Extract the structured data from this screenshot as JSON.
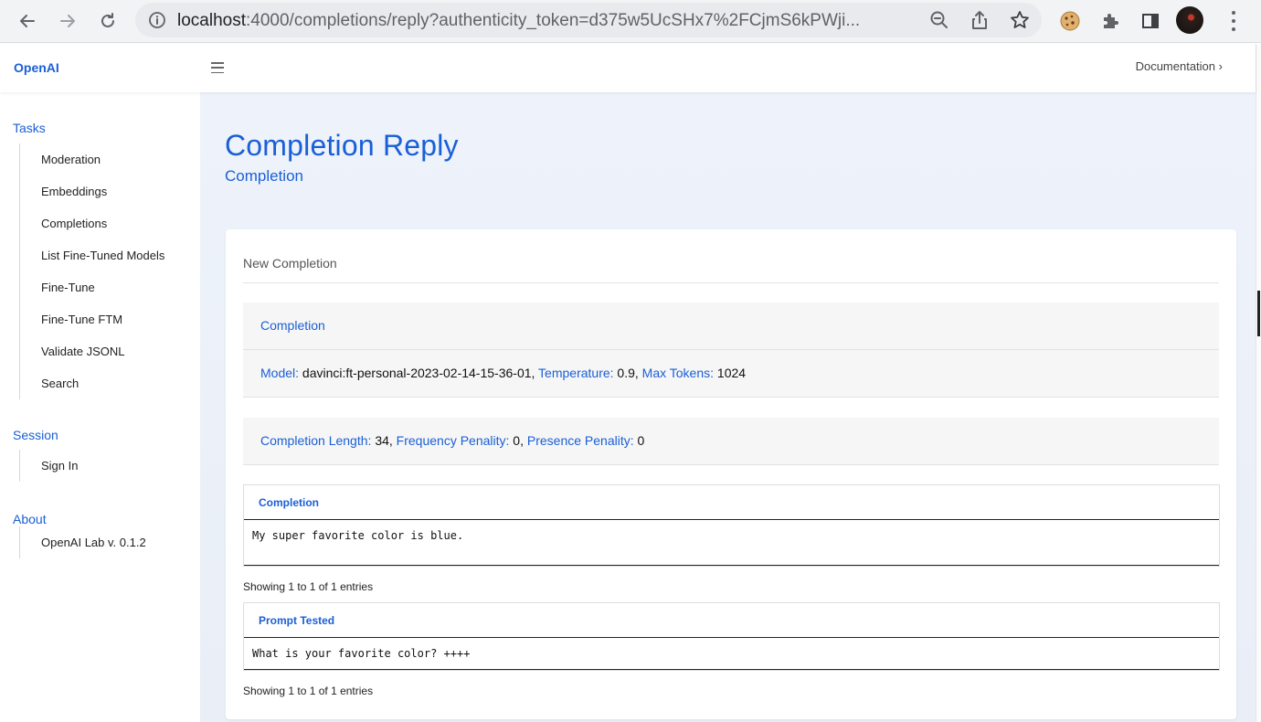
{
  "browser": {
    "url_host": "localhost",
    "url_rest": ":4000/completions/reply?authenticity_token=d375w5UcSHx7%2FCjmS6kPWji..."
  },
  "header": {
    "brand": "OpenAI",
    "documentation_link": "Documentation",
    "documentation_chevron": "›"
  },
  "sidebar": {
    "sections": [
      {
        "title": "Tasks",
        "items": [
          "Moderation",
          "Embeddings",
          "Completions",
          "List Fine-Tuned Models",
          "Fine-Tune",
          "Fine-Tune FTM",
          "Validate JSONL",
          "Search"
        ]
      },
      {
        "title": "Session",
        "items": [
          "Sign In"
        ]
      },
      {
        "title": "About",
        "items": [
          "OpenAI Lab v. 0.1.2"
        ]
      }
    ]
  },
  "page": {
    "title": "Completion Reply",
    "subtitle": "Completion"
  },
  "card": {
    "title": "New Completion",
    "section_label": "Completion",
    "model_label": "Model:",
    "model_value": "davinci:ft-personal-2023-02-14-15-36-01,",
    "temperature_label": "Temperature:",
    "temperature_value": "0.9,",
    "max_tokens_label": "Max Tokens:",
    "max_tokens_value": "1024",
    "length_label": "Completion Length:",
    "length_value": "34,",
    "frequency_label": "Frequency Penality:",
    "frequency_value": "0,",
    "presence_label": "Presence Penality:",
    "presence_value": "0"
  },
  "tables": {
    "completion": {
      "header": "Completion",
      "rows": [
        "My super favorite color is blue."
      ],
      "footer": "Showing 1 to 1 of 1 entries"
    },
    "prompt": {
      "header": "Prompt Tested",
      "rows": [
        "What is your favorite color? ++++"
      ],
      "footer": "Showing 1 to 1 of 1 entries"
    }
  },
  "colors": {
    "accent": "#1a5fd6",
    "main_bg": "#eef3fb"
  }
}
